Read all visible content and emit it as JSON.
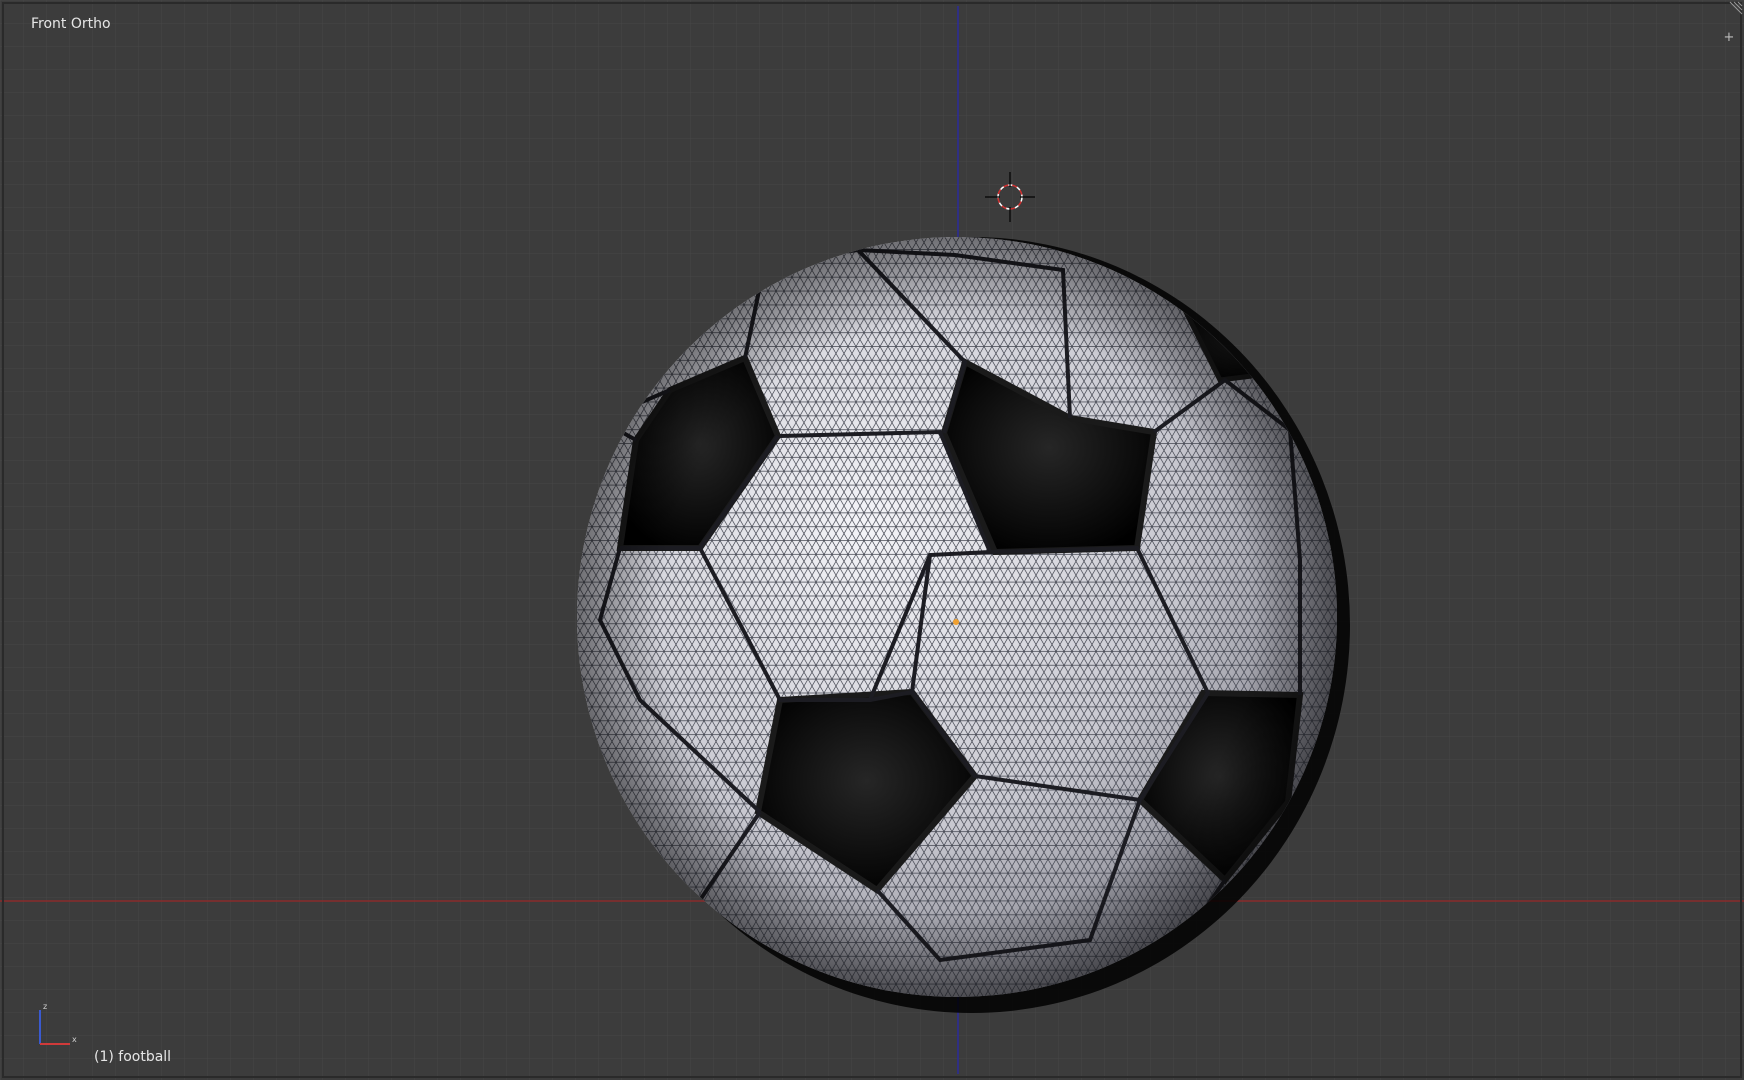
{
  "viewport": {
    "view_label": "Front Ortho",
    "object_label": "(1) football",
    "object_name": "football",
    "expand_icon": "plus-icon",
    "background_color": "#3c3c3c",
    "grid_color": "#464646",
    "x_axis_color": "#8a2b2b",
    "z_axis_color": "#2b2b9a",
    "panel_color": "#e2e2e8",
    "seam_color": "#1a1a1a"
  },
  "gizmo": {
    "x_color": "#d03a3a",
    "z_color": "#3a5ad0"
  }
}
